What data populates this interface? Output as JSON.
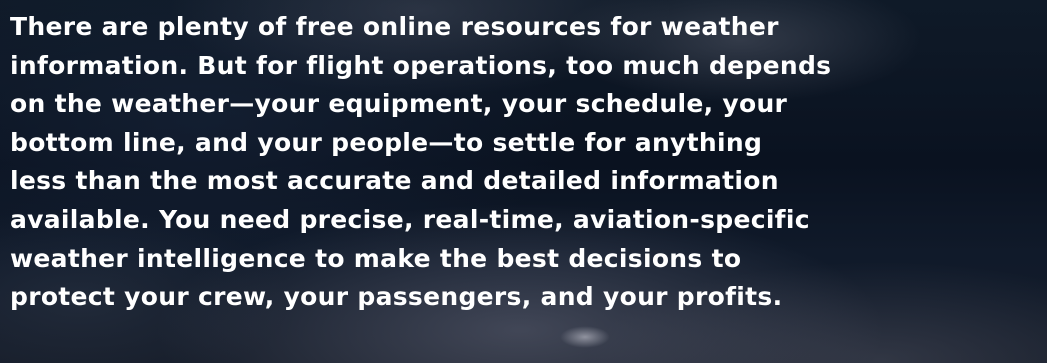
{
  "content": {
    "lines": [
      "There are plenty of free online resources for weather",
      "information. But for flight operations, too much depends",
      "on the weather—your equipment, your schedule, your",
      "bottom line, and your people—to settle for anything",
      "less than the most accurate and detailed information",
      "available. You need precise, real-time, aviation-specific",
      "weather intelligence to make the best decisions to",
      "protect your crew, your passengers, and your profits."
    ]
  }
}
